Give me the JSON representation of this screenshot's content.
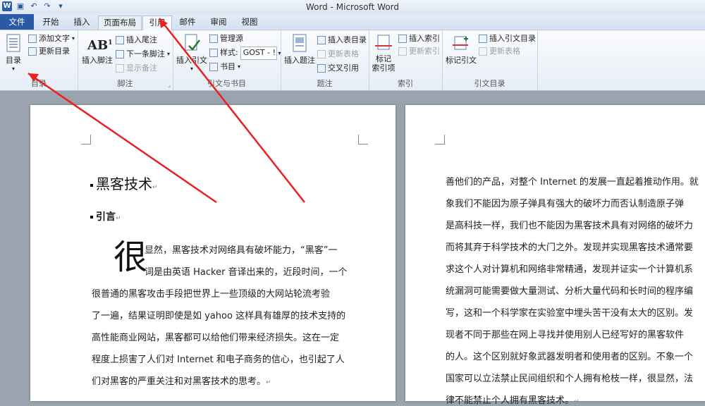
{
  "window": {
    "title": "Word - Microsoft Word"
  },
  "quick_access": {
    "icons": [
      "word-logo",
      "save-icon",
      "undo-icon",
      "redo-icon",
      "customize-icon"
    ]
  },
  "tabs": [
    "文件",
    "开始",
    "插入",
    "页面布局",
    "引用",
    "邮件",
    "审阅",
    "视图"
  ],
  "ribbon": {
    "toc": {
      "big": "目录",
      "add_text": "添加文字",
      "update_toc": "更新目录",
      "label": "目录"
    },
    "footnotes": {
      "insert_footnote": "插入脚注",
      "insert_endnote": "插入尾注",
      "next_footnote": "下一条脚注",
      "show_notes": "显示备注",
      "label": "脚注"
    },
    "citations": {
      "insert_citation": "插入引文",
      "manage_sources": "管理源",
      "style_label": "样式:",
      "style_value": "GOST - !",
      "bibliography": "书目",
      "label": "引文与书目"
    },
    "captions": {
      "insert_caption": "插入题注",
      "insert_table_of_figures": "插入表目录",
      "update_table": "更新表格",
      "cross_reference": "交叉引用",
      "label": "题注"
    },
    "index": {
      "mark_entry": "标记\n索引项",
      "insert_index": "插入索引",
      "update_index": "更新索引",
      "label": "索引"
    },
    "authorities": {
      "mark_citation": "标记引文",
      "insert_toa": "插入引文目录",
      "update_table": "更新表格",
      "label": "引文目录"
    }
  },
  "document": {
    "page1": {
      "heading1": "黑客技术",
      "heading2": "引言",
      "dropcap": "很",
      "lines": [
        "显然，黑客技术对网络具有破坏能力，“黑客”一",
        "词是由英语 Hacker 音译出来的，近段时间，一个",
        "很普通的黑客攻击手段把世界上一些顶级的大网站轮流考验",
        "了一遍，结果证明即使是如 yahoo 这样具有雄厚的技术支持的",
        "高性能商业网站，黑客都可以给他们带来经济损失。这在一定",
        "程度上损害了人们对 Internet 和电子商务的信心，也引起了人",
        "们对黑客的严重关注和对黑客技术的思考。"
      ]
    },
    "page2": {
      "lines": [
        "善他们的产品，对整个 Internet 的发展一直起着推动作用。就",
        "象我们不能因为原子弹具有强大的破坏力而否认制造原子弹",
        "是高科技一样，我们也不能因为黑客技术具有对网络的破坏力",
        "而将其弃于科学技术的大门之外。发现并实现黑客技术通常要",
        "求这个人对计算机和网络非常精通，发现并证实一个计算机系",
        "统漏洞可能需要做大量测试、分析大量代码和长时间的程序编",
        "写，这和一个科学家在实验室中埋头苦干没有太大的区别。发",
        "现者不同于那些在网上寻找并使用别人已经写好的黑客软件",
        "的人。这个区别就好象武器发明者和使用者的区别。不象一个",
        "国家可以立法禁止民间组织和个人拥有枪枝一样，很显然，法",
        "律不能禁止个人拥有黑客技术。"
      ]
    }
  },
  "annotations": {
    "arrow_color": "#e8201e"
  }
}
